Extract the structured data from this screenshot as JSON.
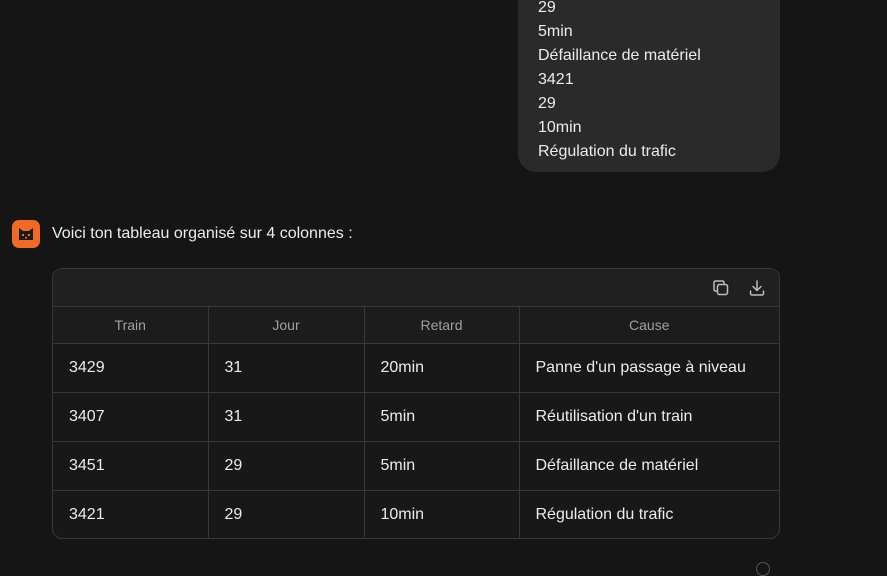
{
  "user_message": {
    "lines": [
      "29",
      "5min",
      "Défaillance de matériel",
      "3421",
      "29",
      "10min",
      "Régulation du trafic"
    ]
  },
  "assistant": {
    "intro": "Voici ton tableau organisé sur 4 colonnes :",
    "table": {
      "headers": [
        "Train",
        "Jour",
        "Retard",
        "Cause"
      ],
      "rows": [
        [
          "3429",
          "31",
          "20min",
          "Panne d'un passage à niveau"
        ],
        [
          "3407",
          "31",
          "5min",
          "Réutilisation d'un train"
        ],
        [
          "3451",
          "29",
          "5min",
          "Défaillance de matériel"
        ],
        [
          "3421",
          "29",
          "10min",
          "Régulation du trafic"
        ]
      ]
    }
  },
  "icons": {
    "avatar": "cat-logo-icon",
    "copy": "copy-icon",
    "download": "download-icon"
  },
  "colors": {
    "background": "#151515",
    "bubble": "#2a2a2a",
    "accent": "#f06a25",
    "border": "#383838",
    "text": "#ececec"
  }
}
